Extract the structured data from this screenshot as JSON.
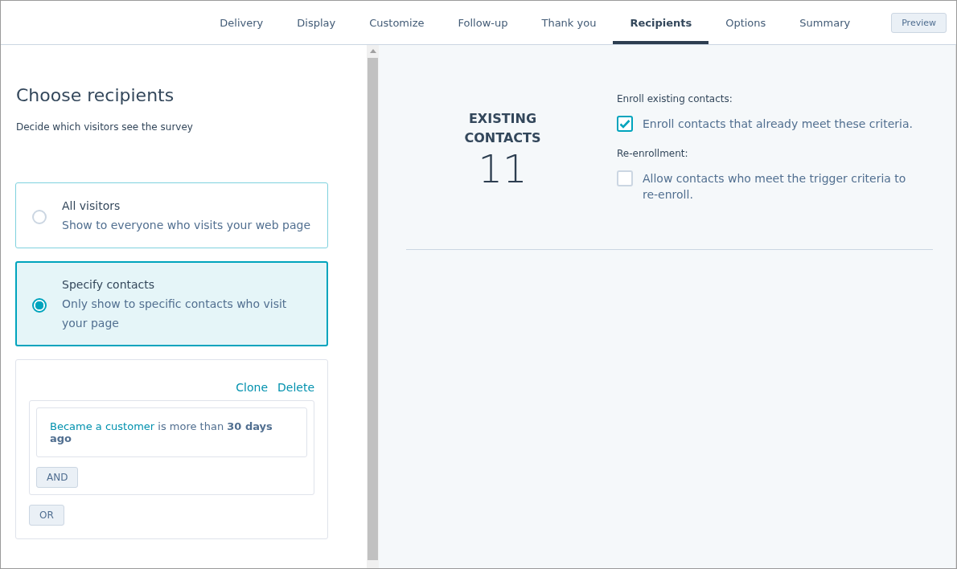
{
  "tabs": [
    {
      "label": "Delivery",
      "selected": false
    },
    {
      "label": "Display",
      "selected": false
    },
    {
      "label": "Customize",
      "selected": false
    },
    {
      "label": "Follow-up",
      "selected": false
    },
    {
      "label": "Thank you",
      "selected": false
    },
    {
      "label": "Recipients",
      "selected": true
    },
    {
      "label": "Options",
      "selected": false
    },
    {
      "label": "Summary",
      "selected": false
    }
  ],
  "preview_button": "Preview",
  "left": {
    "title": "Choose recipients",
    "subtitle": "Decide which visitors see the survey",
    "options": [
      {
        "title": "All visitors",
        "description": "Show to everyone who visits your web page",
        "selected": false
      },
      {
        "title": "Specify contacts",
        "description": "Only show to specific contacts who visit your page",
        "selected": true
      }
    ],
    "filter": {
      "actions": [
        "Clone",
        "Delete"
      ],
      "property": "Became a customer",
      "condition": "is more than **30 days ago**",
      "and_button": "AND",
      "or_button": "OR"
    }
  },
  "right": {
    "count_label": "EXISTING CONTACTS",
    "count": "11",
    "settings": [
      {
        "heading": "Enroll existing contacts:",
        "label": "Enroll contacts that already meet these criteria.",
        "checked": true
      },
      {
        "heading": "Re-enrollment:",
        "label": "Allow contacts who meet the trigger criteria to re-enroll.",
        "checked": false
      }
    ]
  }
}
